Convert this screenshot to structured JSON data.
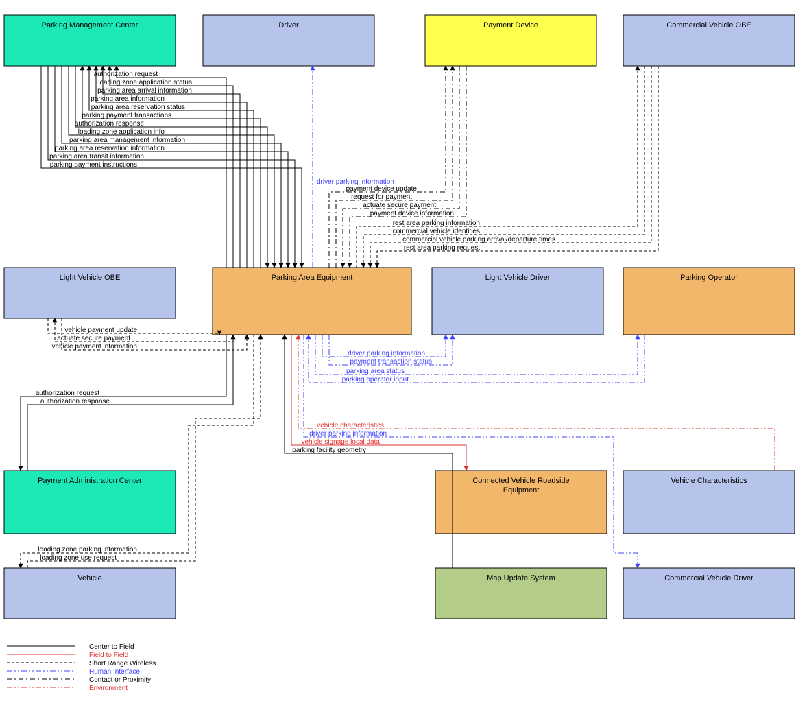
{
  "boxes": {
    "pmc": "Parking Management Center",
    "driver": "Driver",
    "payDev": "Payment Device",
    "cvObe": "Commercial Vehicle OBE",
    "lvObe": "Light Vehicle OBE",
    "pae": "Parking Area Equipment",
    "lvDrv": "Light Vehicle Driver",
    "pOp": "Parking Operator",
    "pac": "Payment Administration Center",
    "cvre": "Connected Vehicle Roadside Equipment",
    "vChar": "Vehicle Characteristics",
    "veh": "Vehicle",
    "mus": "Map Update System",
    "cvDrv": "Commercial Vehicle Driver"
  },
  "pmc_flows": [
    "authorization request",
    "loading zone application status",
    "parking area arrival information",
    "parking area information",
    "parking area reservation status",
    "parking payment transactions",
    "authorization response",
    "loading zone application info",
    "parking area management information",
    "parking area reservation information",
    "parking area transit information",
    "parking payment instructions"
  ],
  "drv_flow": "driver parking information",
  "pay_flows": [
    "payment device update",
    "request for payment",
    "actuate secure payment",
    "payment device information"
  ],
  "cv_flows": [
    "rest area parking information",
    "commercial vehicle identities",
    "commercial vehicle parking arrival/departure times",
    "rest area parking request"
  ],
  "lvobe_flows": [
    "vehicle payment update",
    "actuate secure payment",
    "vehicle payment information"
  ],
  "lvdrv_flows": [
    "driver parking information",
    "payment transaction status"
  ],
  "pop_flows": [
    "parking area status",
    "parking operator input"
  ],
  "pac_flows": [
    "authorization request",
    "authorization response"
  ],
  "veh_flows": [
    "loading zone parking information",
    "loading zone use request"
  ],
  "vchar_flow": "vehicle characteristics",
  "cvdrv_flow": "driver parking information",
  "cvre_flow": "vehicle signage local data",
  "mus_flow": "parking facility geometry",
  "legend": [
    "Center to Field",
    "Field to Field",
    "Short Range Wireless",
    "Human Interface",
    "Contact or Proximity",
    "Environment"
  ]
}
